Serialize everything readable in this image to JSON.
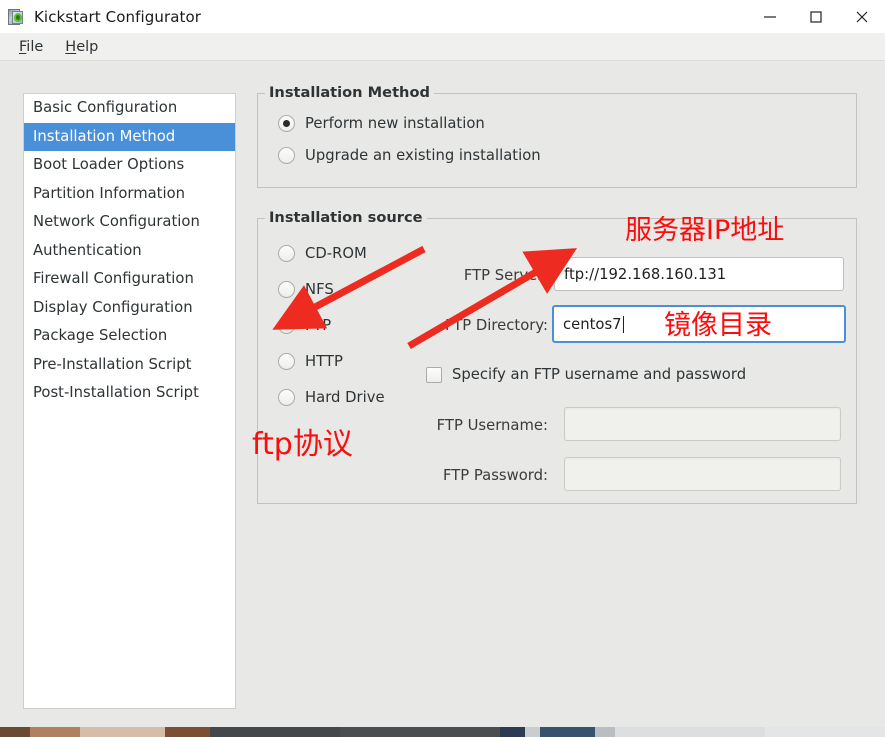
{
  "window": {
    "title": "Kickstart Configurator",
    "icon": "kickstart-app-icon",
    "controls": {
      "minimize": "—",
      "maximize": "□",
      "close": "✕"
    }
  },
  "menubar": {
    "items": [
      {
        "label": "File",
        "mnemonic": "F"
      },
      {
        "label": "Help",
        "mnemonic": "H"
      }
    ]
  },
  "sidebar": {
    "items": [
      {
        "label": "Basic Configuration",
        "selected": false
      },
      {
        "label": "Installation Method",
        "selected": true
      },
      {
        "label": "Boot Loader Options",
        "selected": false
      },
      {
        "label": "Partition Information",
        "selected": false
      },
      {
        "label": "Network Configuration",
        "selected": false
      },
      {
        "label": "Authentication",
        "selected": false
      },
      {
        "label": "Firewall Configuration",
        "selected": false
      },
      {
        "label": "Display Configuration",
        "selected": false
      },
      {
        "label": "Package Selection",
        "selected": false
      },
      {
        "label": "Pre-Installation Script",
        "selected": false
      },
      {
        "label": "Post-Installation Script",
        "selected": false
      }
    ],
    "selected_color": "#4a90d9"
  },
  "installation_method": {
    "legend": "Installation Method",
    "options": [
      {
        "label": "Perform new installation",
        "selected": true
      },
      {
        "label": "Upgrade an existing installation",
        "selected": false
      }
    ]
  },
  "installation_source": {
    "legend": "Installation source",
    "options": [
      {
        "label": "CD-ROM",
        "selected": false
      },
      {
        "label": "NFS",
        "selected": false
      },
      {
        "label": "FTP",
        "selected": true
      },
      {
        "label": "HTTP",
        "selected": false
      },
      {
        "label": "Hard Drive",
        "selected": false
      }
    ],
    "fields": {
      "ftp_server": {
        "label": "FTP Server:",
        "value": "ftp://192.168.160.131",
        "focused": false,
        "disabled": false
      },
      "ftp_directory": {
        "label": "FTP Directory:",
        "value": "centos7",
        "focused": true,
        "disabled": false
      },
      "ftp_username": {
        "label": "FTP Username:",
        "value": "",
        "focused": false,
        "disabled": true
      },
      "ftp_password": {
        "label": "FTP Password:",
        "value": "",
        "focused": false,
        "disabled": true
      }
    },
    "checkbox": {
      "label": "Specify an FTP username and password",
      "checked": false
    }
  },
  "annotations": {
    "color": "#fc0d0d",
    "server_ip": "服务器IP地址",
    "image_dir": "镜像目录",
    "ftp_protocol": "ftp协议"
  }
}
